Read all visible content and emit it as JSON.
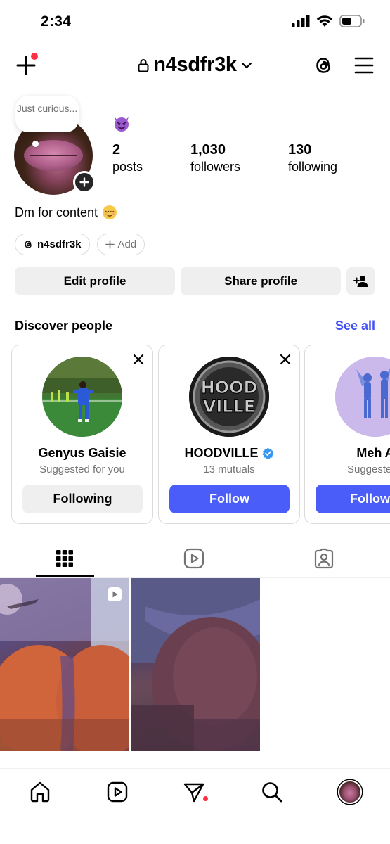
{
  "status": {
    "time": "2:34"
  },
  "header": {
    "username": "n4sdfr3k"
  },
  "note": {
    "text": "Just curious..."
  },
  "profile": {
    "stats": [
      {
        "num": "2",
        "label": "posts"
      },
      {
        "num": "1,030",
        "label": "followers"
      },
      {
        "num": "130",
        "label": "following"
      }
    ],
    "bio": "Dm for content",
    "chips": {
      "threads": "n4sdfr3k",
      "add": "Add"
    }
  },
  "actions": {
    "edit": "Edit profile",
    "share": "Share profile"
  },
  "discover": {
    "title": "Discover people",
    "see_all": "See all",
    "cards": [
      {
        "name": "Genyus Gaisie",
        "sub": "Suggested for you",
        "button": "Following",
        "verified": false
      },
      {
        "name": "HOODVILLE",
        "sub": "13 mutuals",
        "button": "Follow",
        "verified": true
      },
      {
        "name": "Meh A",
        "sub": "Suggested f",
        "button": "Follow b",
        "verified": false
      }
    ],
    "hood_logo": [
      "HOOD",
      "VILLE"
    ]
  },
  "colors": {
    "accent_blue": "#4a5df9",
    "link_blue": "#4150f7",
    "notif_red": "#ff3040",
    "button_gray": "#efefef"
  }
}
